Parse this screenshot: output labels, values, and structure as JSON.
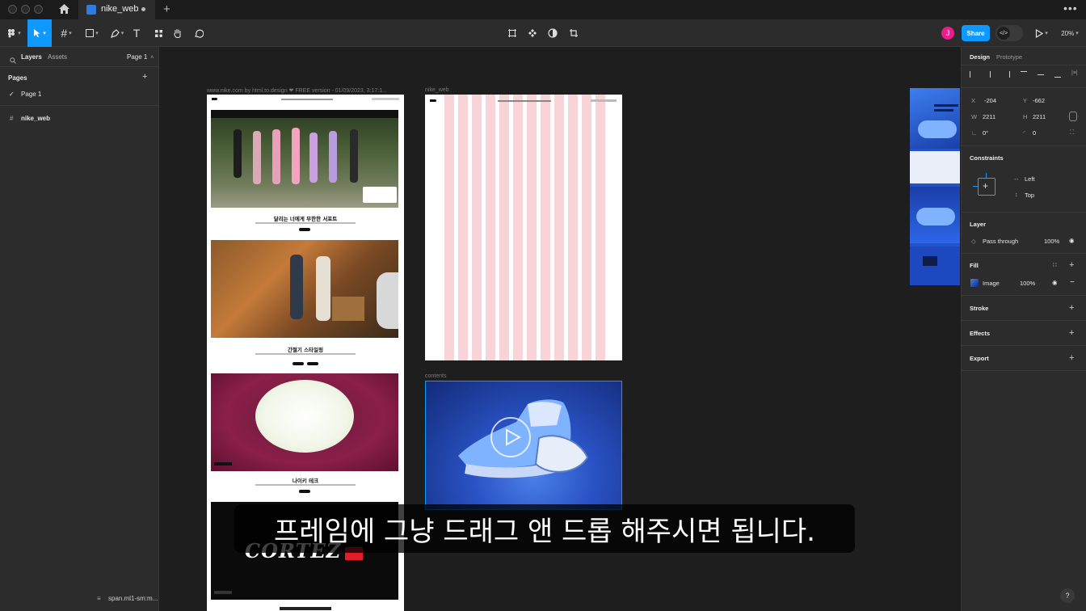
{
  "tab": {
    "title": "nike_web"
  },
  "toolbar": {
    "share_label": "Share",
    "zoom": "20%",
    "avatar_initial": "J"
  },
  "left_panel": {
    "tabs": [
      "Layers",
      "Assets"
    ],
    "page_selector": "Page 1",
    "pages_heading": "Pages",
    "pages": [
      "Page 1"
    ],
    "layers": [
      "nike_web"
    ],
    "bottom_status": "span.ml1-sm:m..."
  },
  "canvas": {
    "frame1_label": "www.nike.com by html.to.design ❤ FREE version - 01/09/2023, 3:17:1...",
    "frame2_label": "nike_web",
    "frame3_label": "contents",
    "sections": [
      {
        "heading": "달리는 너에게 무한한 서포트"
      },
      {
        "heading": "간절기 스타일링"
      },
      {
        "heading": "나이키 테크"
      }
    ],
    "cortez_text": "CORTEZ"
  },
  "right_panel": {
    "tabs": [
      "Design",
      "Prototype"
    ],
    "x_label": "X",
    "x_value": "-204",
    "y_label": "Y",
    "y_value": "-662",
    "w_label": "W",
    "w_value": "2211",
    "h_label": "H",
    "h_value": "2211",
    "rotation": "0°",
    "radius": "0",
    "constraints_heading": "Constraints",
    "constraint_h": "Left",
    "constraint_v": "Top",
    "layer_heading": "Layer",
    "blend_mode": "Pass through",
    "layer_opacity": "100%",
    "fill_heading": "Fill",
    "fill_type": "Image",
    "fill_opacity": "100%",
    "stroke_heading": "Stroke",
    "effects_heading": "Effects",
    "export_heading": "Export"
  },
  "subtitle": "프레임에 그냥 드래그 앤 드롭 해주시면 됩니다.",
  "help_label": "?",
  "colors": {
    "accent": "#0d99ff",
    "avatar": "#e91e8c",
    "grid_column": "#f8d3d8"
  }
}
